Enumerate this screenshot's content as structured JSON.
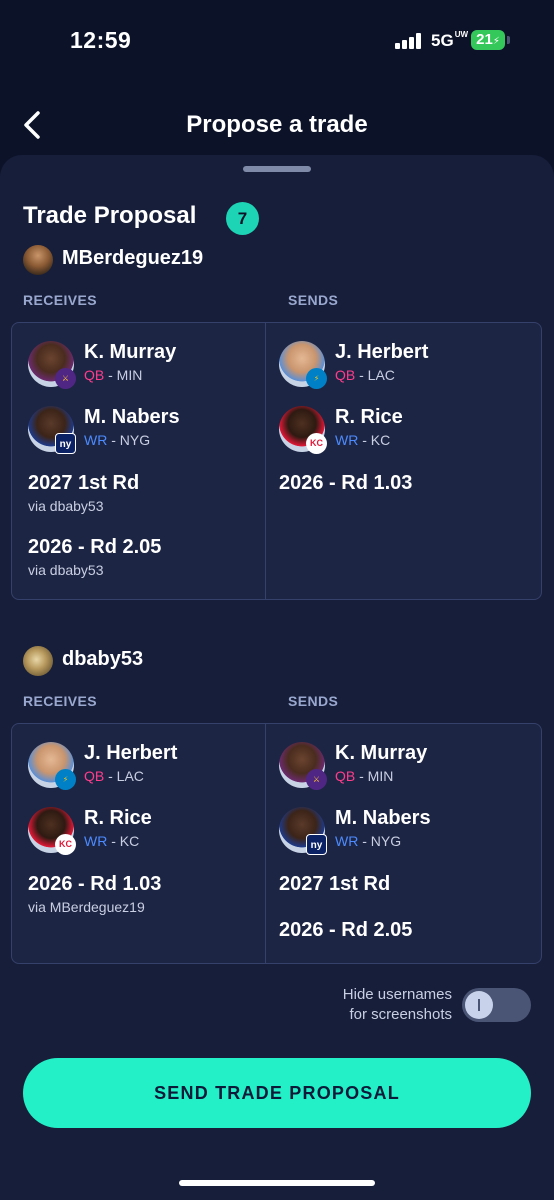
{
  "status_bar": {
    "time": "12:59",
    "network": "5G",
    "network_sub": "UW",
    "battery": "21"
  },
  "header": {
    "title": "Propose a trade"
  },
  "proposal": {
    "title": "Trade Proposal",
    "count": "7"
  },
  "colors": {
    "accent": "#23f0c6",
    "badge": "#1dd4b5",
    "qb": "#ff3d8b",
    "wr": "#4c8bff",
    "background": "#0c1228",
    "sheet": "#171e3a"
  },
  "sections": [
    {
      "user": "MBerdeguez19",
      "receives_label": "RECEIVES",
      "sends_label": "SENDS",
      "receives": {
        "players": [
          {
            "name": "K. Murray",
            "pos": "QB",
            "team": " - MIN",
            "logo": "minnesota-vikings-logo"
          },
          {
            "name": "M. Nabers",
            "pos": "WR",
            "team": " - NYG",
            "logo": "new-york-giants-logo"
          }
        ],
        "picks": [
          {
            "title": "2027 1st Rd",
            "via": "via dbaby53"
          },
          {
            "title": "2026 - Rd 2.05",
            "via": "via dbaby53"
          }
        ]
      },
      "sends": {
        "players": [
          {
            "name": "J. Herbert",
            "pos": "QB",
            "team": " - LAC",
            "logo": "los-angeles-chargers-logo"
          },
          {
            "name": "R. Rice",
            "pos": "WR",
            "team": " - KC",
            "logo": "kansas-city-chiefs-logo"
          }
        ],
        "picks": [
          {
            "title": "2026 - Rd 1.03"
          }
        ]
      }
    },
    {
      "user": "dbaby53",
      "receives_label": "RECEIVES",
      "sends_label": "SENDS",
      "receives": {
        "players": [
          {
            "name": "J. Herbert",
            "pos": "QB",
            "team": " - LAC",
            "logo": "los-angeles-chargers-logo"
          },
          {
            "name": "R. Rice",
            "pos": "WR",
            "team": " - KC",
            "logo": "kansas-city-chiefs-logo"
          }
        ],
        "picks": [
          {
            "title": "2026 - Rd 1.03",
            "via": "via MBerdeguez19"
          }
        ]
      },
      "sends": {
        "players": [
          {
            "name": "K. Murray",
            "pos": "QB",
            "team": " - MIN",
            "logo": "minnesota-vikings-logo"
          },
          {
            "name": "M. Nabers",
            "pos": "WR",
            "team": " - NYG",
            "logo": "new-york-giants-logo"
          }
        ],
        "picks": [
          {
            "title": "2027 1st Rd"
          },
          {
            "title": "2026 - Rd 2.05"
          }
        ]
      }
    }
  ],
  "toggle": {
    "label_line1": "Hide usernames",
    "label_line2": "for screenshots"
  },
  "actions": {
    "send_label": "SEND TRADE PROPOSAL"
  }
}
